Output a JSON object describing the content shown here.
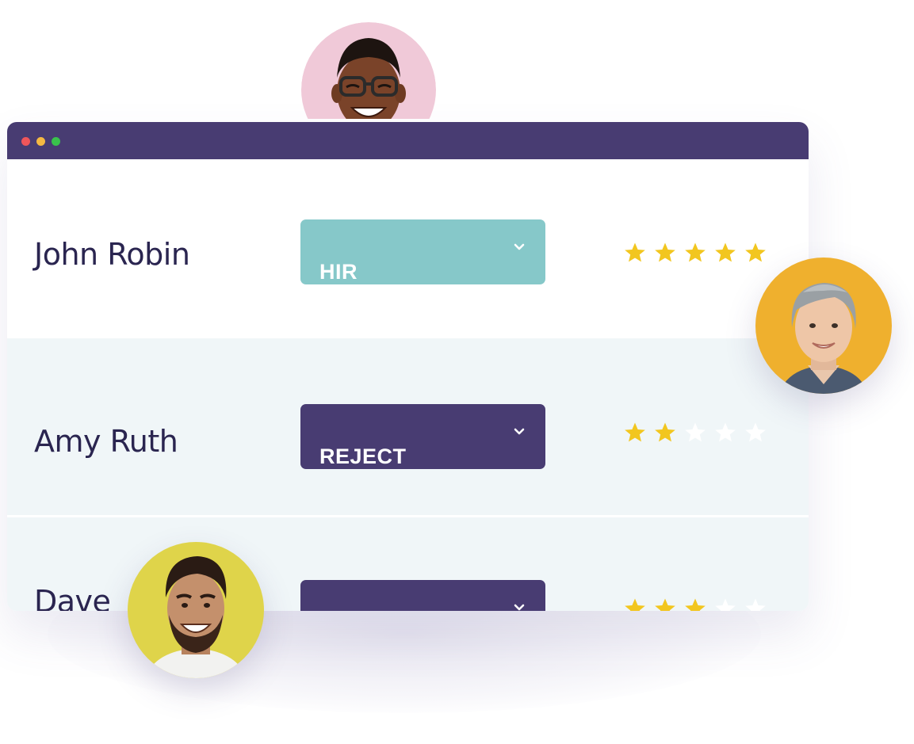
{
  "window": {
    "titlebar_color": "#483c72",
    "dots": [
      "#f0565a",
      "#f5b942",
      "#39c24c"
    ]
  },
  "candidates": [
    {
      "name": "John Robin",
      "status": "HIR",
      "status_color": "#86c8c9",
      "rating": 5,
      "rating_max": 5
    },
    {
      "name": "Amy Ruth",
      "status": "REJECT",
      "status_color": "#483c72",
      "rating": 2,
      "rating_max": 5
    },
    {
      "name": "Dave",
      "status": "",
      "status_color": "#483c72",
      "rating": 3,
      "rating_max": 5
    }
  ],
  "colors": {
    "star_filled": "#f2c61f",
    "star_empty": "#ffffff",
    "name_text": "#2a2550",
    "row_alt_bg": "#f0f6f8"
  },
  "avatars": [
    {
      "icon": "person-avatar-icon",
      "bg": "#f0c9d8"
    },
    {
      "icon": "person-avatar-icon",
      "bg": "#efb02e"
    },
    {
      "icon": "person-avatar-icon",
      "bg": "#dfd44a"
    }
  ]
}
